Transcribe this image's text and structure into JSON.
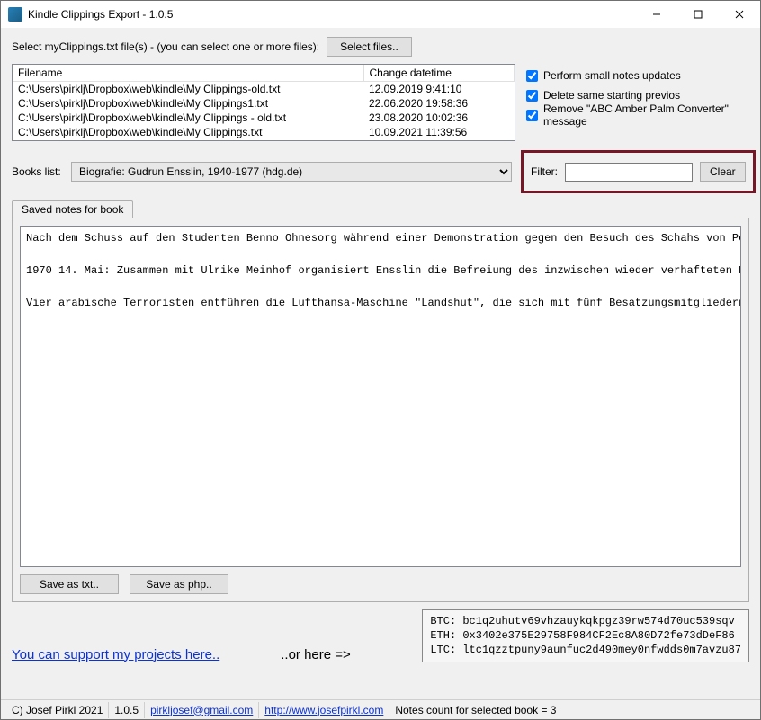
{
  "window": {
    "title": "Kindle Clippings Export - 1.0.5"
  },
  "selectFiles": {
    "label": "Select myClippings.txt file(s) - (you can select one or more files):",
    "button": "Select files.."
  },
  "fileTable": {
    "headers": {
      "filename": "Filename",
      "changedt": "Change datetime"
    },
    "rows": [
      {
        "filename": "C:\\Users\\pirklj\\Dropbox\\web\\kindle\\My Clippings-old.txt",
        "dt": "12.09.2019 9:41:10"
      },
      {
        "filename": "C:\\Users\\pirklj\\Dropbox\\web\\kindle\\My Clippings1.txt",
        "dt": "22.06.2020 19:58:36"
      },
      {
        "filename": "C:\\Users\\pirklj\\Dropbox\\web\\kindle\\My Clippings - old.txt",
        "dt": "23.08.2020 10:02:36"
      },
      {
        "filename": "C:\\Users\\pirklj\\Dropbox\\web\\kindle\\My Clippings.txt",
        "dt": "10.09.2021 11:39:56"
      }
    ]
  },
  "checks": {
    "c1": "Perform small notes updates",
    "c2": "Delete same starting previos",
    "c3": "Remove \"ABC Amber Palm Converter\" message"
  },
  "books": {
    "label": "Books list:",
    "selected": "Biografie: Gudrun Ensslin, 1940-1977 (hdg.de)"
  },
  "filter": {
    "label": "Filter:",
    "value": "",
    "clear": "Clear"
  },
  "tab": {
    "label": "Saved notes for book"
  },
  "notes": {
    "text": "Nach dem Schuss auf den Studenten Benno Ohnesorg während einer Demonstration gegen den Besuch des Schahs von Pe\n\n1970 14. Mai: Zusammen mit Ulrike Meinhof organisiert Ensslin die Befreiung des inzwischen wieder verhafteten B\n\nVier arabische Terroristen entführen die Lufthansa-Maschine \"Landshut\", die sich mit fünf Besatzungsmitgliedern"
  },
  "save": {
    "txt": "Save as txt..",
    "php": "Save as php.."
  },
  "support": {
    "link": "You can support my projects here..",
    "orhere": "..or here =>",
    "crypto": {
      "btc": "BTC: bc1q2uhutv69vhzauykqkpgz39rw574d70uc539sqv",
      "eth": "ETH: 0x3402e375E29758F984CF2Ec8A80D72fe73dDeF86",
      "ltc": "LTC: ltc1qzztpuny9aunfuc2d490mey0nfwdds0m7avzu87"
    }
  },
  "status": {
    "copyright": "C) Josef Pirkl 2021",
    "version": "1.0.5",
    "email": "pirkljosef@gmail.com",
    "url": "http://www.josefpirkl.com",
    "count": "Notes count for selected book = 3"
  }
}
